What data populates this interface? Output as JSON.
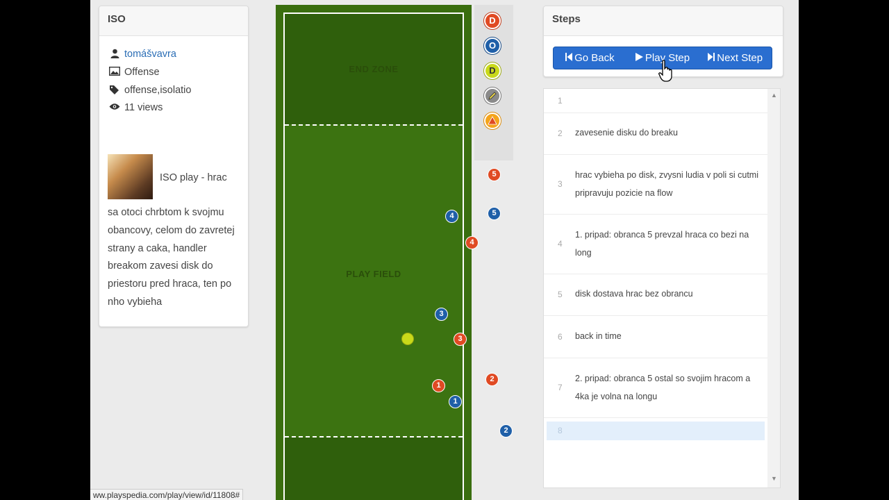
{
  "play": {
    "title": "ISO",
    "author": "tomášvavra",
    "category": "Offense",
    "tags": "offense,isolatio",
    "views": "11 views",
    "desc_title": "ISO play - hrac",
    "desc_body": "sa otoci chrbtom k svojmu obancovy, celom do zavretej strany a caka, handler breakom zavesi disk do priestoru pred hraca, ten po nho vybieha"
  },
  "field": {
    "endzone_label": "END ZONE",
    "playfield_label": "PLAY FIELD",
    "players": [
      {
        "team": "d",
        "num": "5"
      },
      {
        "team": "o",
        "num": "4"
      },
      {
        "team": "o",
        "num": "5"
      },
      {
        "team": "d",
        "num": "4"
      },
      {
        "team": "o",
        "num": "3"
      },
      {
        "team": "d",
        "num": "3"
      },
      {
        "team": "d",
        "num": "1"
      },
      {
        "team": "d",
        "num": "2"
      },
      {
        "team": "o",
        "num": "1"
      },
      {
        "team": "o",
        "num": "2"
      }
    ]
  },
  "palette": {
    "defense": "D",
    "offense": "O",
    "disc": "D",
    "line_icon": "pencil-icon",
    "cone_icon": "cone-icon"
  },
  "steps": {
    "title": "Steps",
    "go_back": "Go Back",
    "play_step": "Play Step",
    "next_step": "Next Step",
    "items": [
      {
        "num": "1",
        "text": ""
      },
      {
        "num": "2",
        "text": "zavesenie disku do breaku"
      },
      {
        "num": "3",
        "text": "hrac vybieha po disk, zvysni ludia v poli si cutmi pripravuju pozicie na flow"
      },
      {
        "num": "4",
        "text": "1. pripad: obranca 5 prevzal hraca co bezi na long"
      },
      {
        "num": "5",
        "text": "disk dostava hrac bez obrancu"
      },
      {
        "num": "6",
        "text": "back in time"
      },
      {
        "num": "7",
        "text": "2. pripad: obranca 5 ostal so svojim hracom a 4ka je volna na longu"
      },
      {
        "num": "8",
        "text": ""
      }
    ]
  },
  "status_url": "ww.playspedia.com/play/view/id/11808#",
  "colors": {
    "offense": "#1f5fa8",
    "defense": "#e04a23",
    "disc": "#c9d91a",
    "button": "#2a6ed0",
    "field": "#3c7311",
    "link": "#2a6db5"
  }
}
